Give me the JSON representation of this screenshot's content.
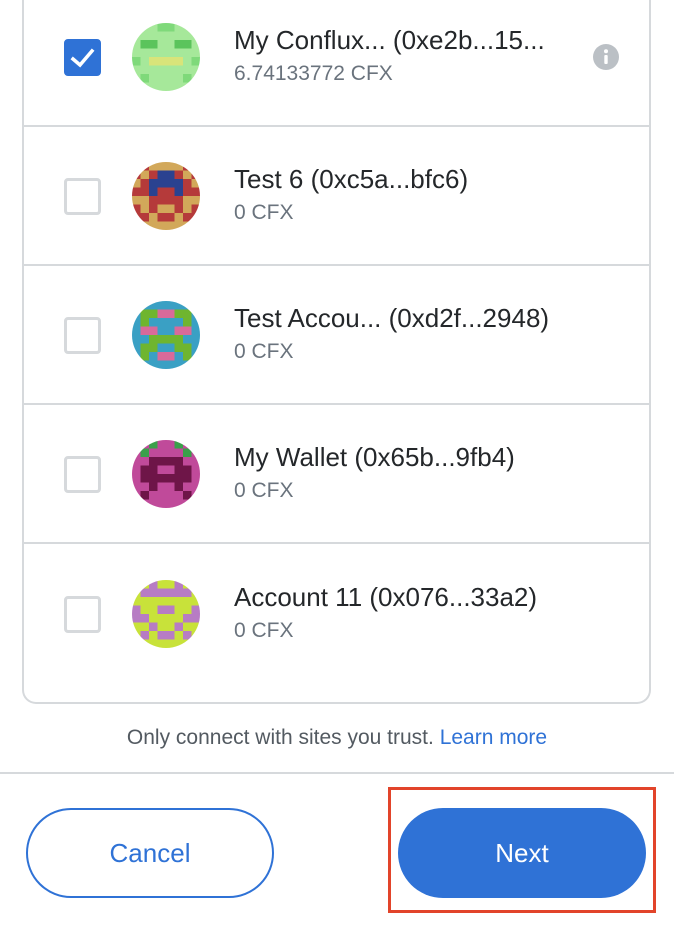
{
  "accounts": [
    {
      "name": "My Conflux... (0xe2b...15...",
      "balance": "6.74133772 CFX",
      "checked": true,
      "info_icon": "info-icon",
      "avatar_colors": [
        "#7fd97a",
        "#a6e89a",
        "#5bc45c",
        "#d8e47a"
      ]
    },
    {
      "name": "Test 6 (0xc5a...bfc6)",
      "balance": "0 CFX",
      "checked": false,
      "avatar_colors": [
        "#3b57a8",
        "#b53a3a",
        "#d2a85a",
        "#2a4290"
      ]
    },
    {
      "name": "Test Accou... (0xd2f...2948)",
      "balance": "0 CFX",
      "checked": false,
      "avatar_colors": [
        "#8bc43a",
        "#3aa0c4",
        "#d96a9a",
        "#6fb52f"
      ]
    },
    {
      "name": "My Wallet (0x65b...9fb4)",
      "balance": "0 CFX",
      "checked": false,
      "avatar_colors": [
        "#8a1f5c",
        "#c04a9a",
        "#3aa04a",
        "#6e1548"
      ]
    },
    {
      "name": "Account 11 (0x076...33a2)",
      "balance": "0 CFX",
      "checked": false,
      "avatar_colors": [
        "#d9a6df",
        "#c8e23a",
        "#b77cc4",
        "#e8c8ee"
      ]
    }
  ],
  "trust": {
    "text": "Only connect with sites you trust.",
    "learn_more": "Learn more"
  },
  "buttons": {
    "cancel": "Cancel",
    "next": "Next"
  },
  "colors": {
    "accent": "#2f72d6",
    "highlight": "#e2442a",
    "border": "#d6d9dc"
  }
}
